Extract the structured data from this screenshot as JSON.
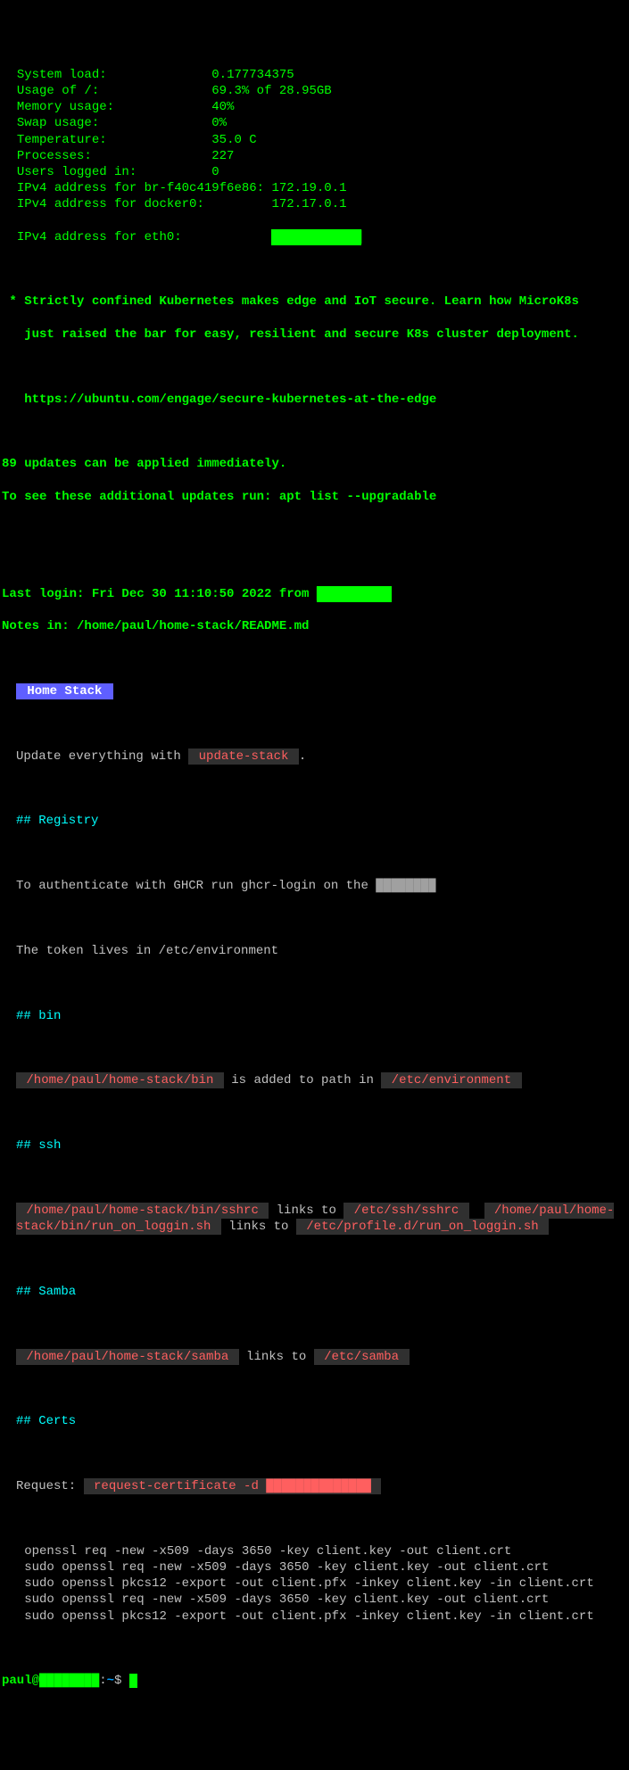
{
  "sysinfo": [
    {
      "label": "  System load:",
      "pad": "              ",
      "value": "0.177734375"
    },
    {
      "label": "  Usage of /:",
      "pad": "               ",
      "value": "69.3% of 28.95GB"
    },
    {
      "label": "  Memory usage:",
      "pad": "             ",
      "value": "40%"
    },
    {
      "label": "  Swap usage:",
      "pad": "               ",
      "value": "0%"
    },
    {
      "label": "  Temperature:",
      "pad": "              ",
      "value": "35.0 C"
    },
    {
      "label": "  Processes:",
      "pad": "                ",
      "value": "227"
    },
    {
      "label": "  Users logged in:",
      "pad": "          ",
      "value": "0"
    },
    {
      "label": "  IPv4 address for br-f40c419f6e86:",
      "pad": " ",
      "value": "172.19.0.1"
    },
    {
      "label": "  IPv4 address for docker0:",
      "pad": "         ",
      "value": "172.17.0.1"
    }
  ],
  "eth0": {
    "label": "  IPv4 address for eth0:",
    "pad": "            "
  },
  "motd": {
    "line1": " * Strictly confined Kubernetes makes edge and IoT secure. Learn how MicroK8s",
    "line2": "   just raised the bar for easy, resilient and secure K8s cluster deployment.",
    "url": "   https://ubuntu.com/engage/secure-kubernetes-at-the-edge"
  },
  "updates": {
    "line1": "89 updates can be applied immediately.",
    "line2": "To see these additional updates run: apt list --upgradable"
  },
  "lastlogin": "Last login: Fri Dec 30 11:10:50 2022 from ",
  "notes": "Notes in: /home/paul/home-stack/README.md",
  "readme": {
    "title": " Home Stack ",
    "update_pre": "Update everything with ",
    "update_cmd": " update-stack ",
    "update_post": ".",
    "h_registry": "## Registry",
    "reg_text": "To authenticate with GHCR run ghcr-login on the ",
    "reg_token": "The token lives in /etc/environment",
    "h_bin": "## bin",
    "bin_path": " /home/paul/home-stack/bin ",
    "bin_mid": " is added to path in ",
    "bin_env": " /etc/environment ",
    "h_ssh": "## ssh",
    "ssh_p1": " /home/paul/home-stack/bin/sshrc ",
    "ssh_t1": " links to ",
    "ssh_p2": " /etc/ssh/sshrc ",
    "ssh_sp": "  ",
    "ssh_p3": " /home/paul/home-stack/bin/run_on_loggin.sh ",
    "ssh_t2": " links to ",
    "ssh_p4": " /etc/profile.d/run_on_loggin.sh ",
    "h_samba": "## Samba",
    "samba_p1": " /home/paul/home-stack/samba ",
    "samba_t": " links to ",
    "samba_p2": " /etc/samba ",
    "h_certs": "## Certs",
    "cert_req_label": "Request: ",
    "cert_req_cmd": " request-certificate -d ",
    "code": [
      "   openssl req -new -x509 -days 3650 -key client.key -out client.crt",
      "   sudo openssl req -new -x509 -days 3650 -key client.key -out client.crt",
      "   sudo openssl pkcs12 -export -out client.pfx -inkey client.key -in client.crt",
      "   sudo openssl req -new -x509 -days 3650 -key client.key -out client.crt",
      "   sudo openssl pkcs12 -export -out client.pfx -inkey client.key -in client.crt"
    ]
  },
  "prompt": {
    "user": "paul",
    "at": "@",
    "host": "████████",
    "colon": ":",
    "path": "~",
    "dollar": "$ "
  }
}
